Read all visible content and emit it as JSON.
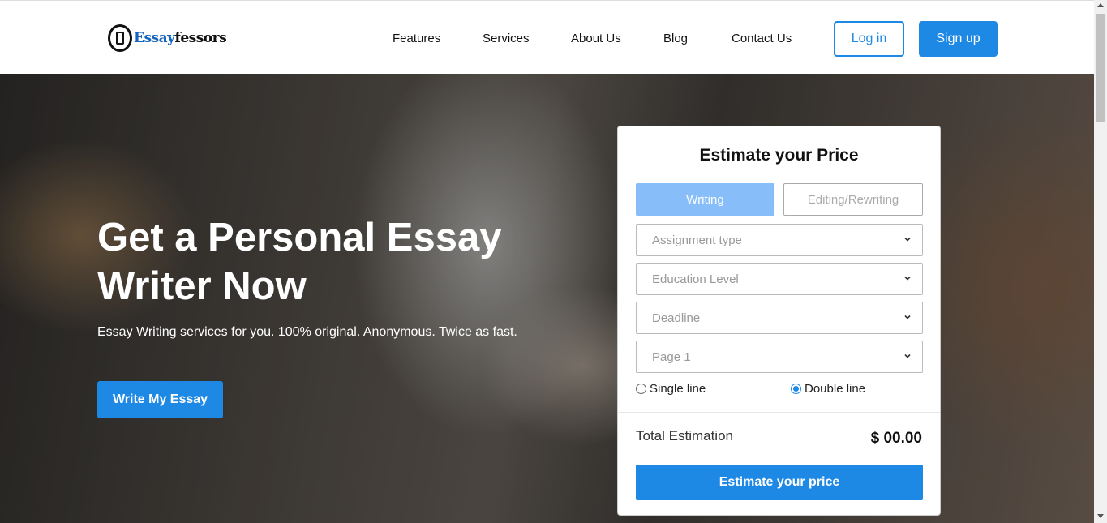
{
  "brand": {
    "logo_part1": "Essay",
    "logo_part2": "fessors"
  },
  "nav": {
    "items": [
      {
        "label": "Features"
      },
      {
        "label": "Services"
      },
      {
        "label": "About Us"
      },
      {
        "label": "Blog"
      },
      {
        "label": "Contact Us"
      }
    ],
    "login_label": "Log in",
    "signup_label": "Sign up"
  },
  "hero": {
    "title": "Get a Personal Essay Writer Now",
    "subtitle": "Essay Writing services for you. 100% original. Anonymous. Twice as fast.",
    "cta_label": "Write My Essay"
  },
  "estimate": {
    "title": "Estimate your Price",
    "tabs": [
      {
        "label": "Writing",
        "active": true
      },
      {
        "label": "Editing/Rewriting",
        "active": false
      }
    ],
    "selects": [
      {
        "placeholder": "Assignment type"
      },
      {
        "placeholder": "Education Level"
      },
      {
        "placeholder": "Deadline"
      },
      {
        "placeholder": "Page 1"
      }
    ],
    "spacing_options": [
      {
        "label": "Single line",
        "checked": false
      },
      {
        "label": "Double line",
        "checked": true
      }
    ],
    "total_label": "Total Estimation",
    "total_value": "$ 00.00",
    "button_label": "Estimate your price"
  },
  "colors": {
    "accent": "#1e88e5",
    "tab_active": "#87bdf8",
    "logo_blue": "#1565c0"
  },
  "icons": [
    "logo-icon",
    "chevron-down-icon",
    "scroll-up-icon",
    "scroll-down-icon"
  ]
}
